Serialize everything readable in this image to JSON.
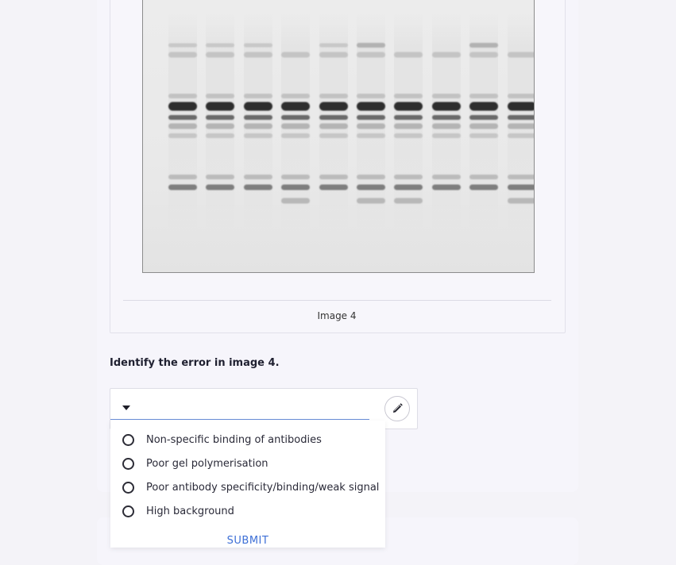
{
  "figure": {
    "caption": "Image 4"
  },
  "question": {
    "text": "Identify the error in image 4."
  },
  "answer": {
    "selected_value": "",
    "edit_icon": "pencil-icon",
    "options": [
      "Non-specific binding of antibodies",
      "Poor gel polymerisation",
      "Poor antibody specificity/binding/weak signal",
      "High background"
    ],
    "submit_label": "SUBMIT"
  },
  "colors": {
    "accent": "#3d6fd6",
    "underline": "#6a8ed8"
  }
}
